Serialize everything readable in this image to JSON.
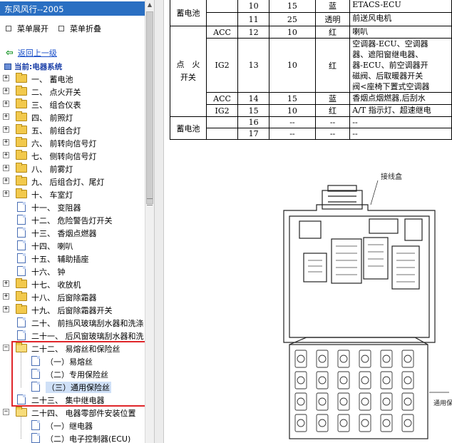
{
  "window": {
    "title": "东风风行--2005"
  },
  "toolbar": {
    "expand_label": "菜单展开",
    "collapse_label": "菜单折叠"
  },
  "nav": {
    "back_label": "返回上一级",
    "current_label": "当前:电器系统"
  },
  "tree": {
    "items": [
      {
        "label": "一、 蓄电池",
        "kind": "folder"
      },
      {
        "label": "二、 点火开关",
        "kind": "folder"
      },
      {
        "label": "三、 组合仪表",
        "kind": "folder"
      },
      {
        "label": "四、 前照灯",
        "kind": "folder"
      },
      {
        "label": "五、 前组合灯",
        "kind": "folder"
      },
      {
        "label": "六、 前转向信号灯",
        "kind": "folder"
      },
      {
        "label": "七、 侧转向信号灯",
        "kind": "folder"
      },
      {
        "label": "八、 前雾灯",
        "kind": "folder"
      },
      {
        "label": "九、 后组合灯、尾灯",
        "kind": "folder"
      },
      {
        "label": "十、 车室灯",
        "kind": "folder"
      },
      {
        "label": "十一、 变阻器",
        "kind": "doc"
      },
      {
        "label": "十二、 危险警告灯开关",
        "kind": "doc"
      },
      {
        "label": "十三、 香烟点燃器",
        "kind": "doc"
      },
      {
        "label": "十四、 喇叭",
        "kind": "doc"
      },
      {
        "label": "十五、 辅助插座",
        "kind": "doc"
      },
      {
        "label": "十六、 钟",
        "kind": "doc"
      },
      {
        "label": "十七、 收放机",
        "kind": "folder"
      },
      {
        "label": "十八、 后窗除霜器",
        "kind": "folder"
      },
      {
        "label": "十九、 后窗除霜器开关",
        "kind": "folder"
      },
      {
        "label": "二十、 前挡风玻璃刮水器和洗涤",
        "kind": "doc"
      },
      {
        "label": "二十一、 后风窗玻璃刮水器和洗",
        "kind": "doc"
      },
      {
        "label": "二十二、 易熔丝和保险丝",
        "kind": "folder-open"
      },
      {
        "label": "（一）易熔丝",
        "kind": "child"
      },
      {
        "label": "（二）专用保险丝",
        "kind": "child"
      },
      {
        "label": "（三）通用保险丝",
        "kind": "child-selected"
      },
      {
        "label": "二十三、 集中继电器",
        "kind": "doc"
      },
      {
        "label": "二十四、 电器零部件安装位置",
        "kind": "folder-open"
      },
      {
        "label": "（一）继电器",
        "kind": "child"
      },
      {
        "label": "（二）电子控制器(ECU)",
        "kind": "child"
      }
    ]
  },
  "fuse_table": {
    "group_battery": "蓄电池",
    "group_ignition": "点　火\n开关",
    "rows": [
      {
        "pos": "",
        "no": "10",
        "amp": "15",
        "color": "蓝",
        "desc": "ETACS-ECU"
      },
      {
        "pos": "",
        "no": "11",
        "amp": "25",
        "color": "透明",
        "desc": "前送风电机"
      },
      {
        "pos": "ACC",
        "no": "12",
        "amp": "10",
        "color": "红",
        "desc": "喇叭"
      },
      {
        "pos": "IG2",
        "no": "13",
        "amp": "10",
        "color": "红",
        "desc": "空调器-ECU、空调器\n器、遮阳窗继电器、\n器-ECU、前空调器开\n磁阀、后取暖器开关\n阀<座椅下置式空调器"
      },
      {
        "pos": "ACC",
        "no": "14",
        "amp": "15",
        "color": "蓝",
        "desc": "香烟点烟燃器,后刮水"
      },
      {
        "pos": "IG2",
        "no": "15",
        "amp": "10",
        "color": "红",
        "desc": "A/T 指示灯、超速继电"
      },
      {
        "pos": "",
        "no": "16",
        "amp": "--",
        "color": "--",
        "desc": "--"
      },
      {
        "pos": "",
        "no": "17",
        "amp": "--",
        "color": "--",
        "desc": "--"
      }
    ]
  },
  "diagram": {
    "label_junction": "接线盒",
    "label_general_fuse": "通用保"
  },
  "colors": {
    "titlebar": "#2a6fc2",
    "highlight": "#e0262a",
    "selection": "#cfe0f7"
  }
}
